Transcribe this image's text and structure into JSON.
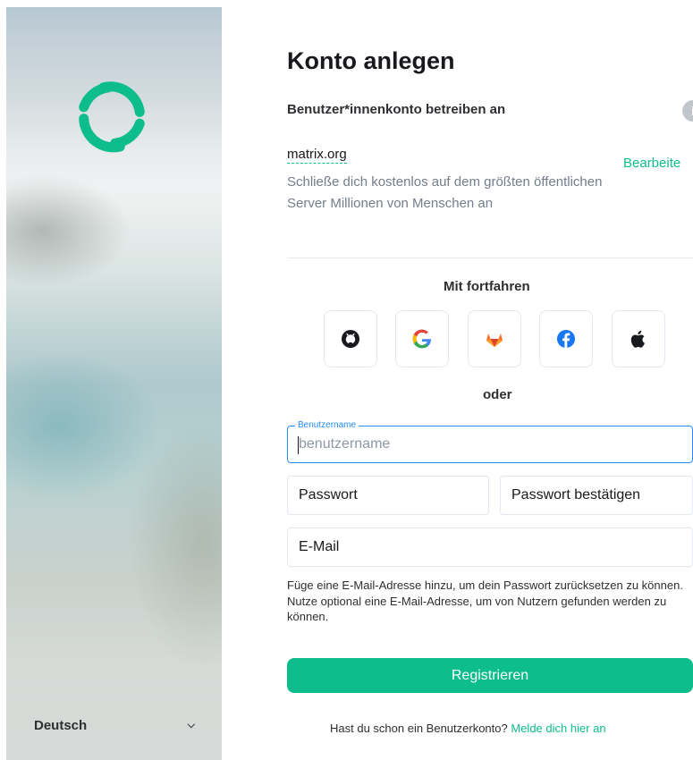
{
  "brand": {
    "accent": "#0dbd8b",
    "link": "#0dbd8b",
    "focus": "#238cf5"
  },
  "language": {
    "selected": "Deutsch"
  },
  "header": {
    "title": "Konto anlegen",
    "subtitle": "Benutzer*innenkonto betreiben an",
    "info_icon": "i"
  },
  "server": {
    "name": "matrix.org",
    "edit_label": "Bearbeite",
    "description": "Schließe dich kostenlos auf dem größten öffentlichen Server Millionen von Menschen an"
  },
  "sso": {
    "heading": "Mit fortfahren",
    "providers": [
      "github-icon",
      "google-icon",
      "gitlab-icon",
      "facebook-icon",
      "apple-icon"
    ],
    "separator": "oder"
  },
  "form": {
    "username": {
      "label": "Benutzername",
      "placeholder": "benutzername"
    },
    "password": {
      "placeholder": "Passwort"
    },
    "password_confirm": {
      "placeholder": "Passwort bestätigen"
    },
    "email": {
      "placeholder": "E-Mail"
    },
    "email_hint": "Füge eine E-Mail-Adresse hinzu, um dein Passwort zurücksetzen zu können. Nutze optional eine E-Mail-Adresse, um von Nutzern gefunden werden zu können.",
    "submit_label": "Registrieren"
  },
  "footer": {
    "question": "Hast du schon ein Benutzerkonto?",
    "login_link": "Melde dich hier an"
  }
}
